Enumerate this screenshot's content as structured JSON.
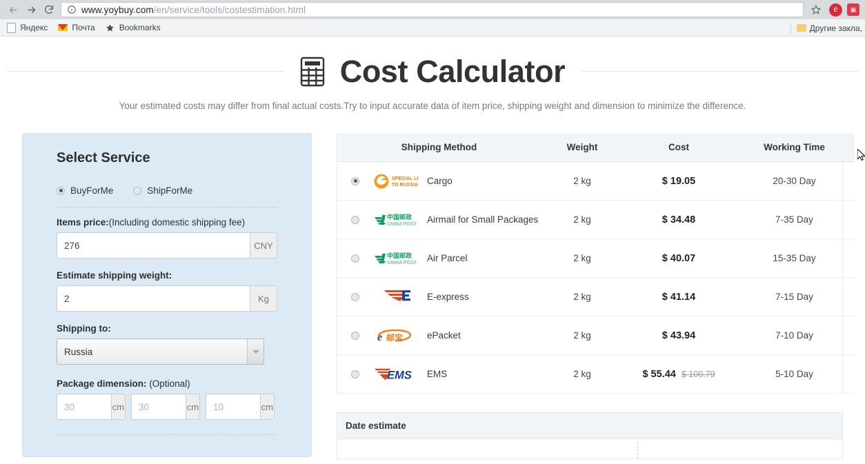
{
  "browser": {
    "back_icon": "back-arrow-icon",
    "forward_icon": "forward-arrow-icon",
    "reload_icon": "reload-icon",
    "url_secure_part": "www.yoybuy.com",
    "url_path_part": "/en/service/tools/costestimation.html",
    "bookmark_star_icon": "star-icon",
    "extensions": [
      {
        "name": "edge-extension-icon",
        "glyph": "e"
      },
      {
        "name": "red-square-extension-icon",
        "glyph": ""
      }
    ],
    "bookmarks": [
      {
        "label": "Яндекс",
        "icon": "page-icon"
      },
      {
        "label": "Почта",
        "icon": "envelope-icon"
      },
      {
        "label": "Bookmarks",
        "icon": "star-icon"
      }
    ],
    "other_bookmarks_label": "Другие закла,",
    "other_bookmarks_icon": "folder-icon"
  },
  "header": {
    "icon": "calculator-icon",
    "title": "Cost Calculator",
    "subtitle": "Your estimated costs may differ from final actual costs.Try to input accurate data of item price, shipping weight and dimension to minimize the difference."
  },
  "form": {
    "title": "Select Service",
    "service_options": [
      {
        "label": "BuyForMe",
        "selected": true
      },
      {
        "label": "ShipForMe",
        "selected": false
      }
    ],
    "items_price": {
      "label_bold": "Items price:",
      "label_normal": "(Including domestic shipping fee)",
      "value": "276",
      "placeholder": "",
      "unit": "CNY"
    },
    "weight": {
      "label": "Estimate shipping weight:",
      "value": "2",
      "placeholder": "",
      "unit": "Kg"
    },
    "shipping_to": {
      "label": "Shipping to:",
      "value": "Russia",
      "arrow_icon": "chevron-down-icon"
    },
    "package_dimension": {
      "label_bold": "Package dimension:",
      "label_normal": "(Optional)",
      "fields": [
        {
          "value": "",
          "placeholder": "30",
          "unit": "cm"
        },
        {
          "value": "",
          "placeholder": "30",
          "unit": "cm"
        },
        {
          "value": "",
          "placeholder": "10",
          "unit": "cm"
        }
      ]
    }
  },
  "results": {
    "columns": [
      "Shipping Method",
      "Weight",
      "Cost",
      "Working Time"
    ],
    "rows": [
      {
        "selected": true,
        "logo": "special-line-to-russia-logo",
        "logo_text_line1": "SPECIAL LINE",
        "logo_text_line2": "TO RUSSIA",
        "method": "Cargo",
        "weight": "2 kg",
        "cost": "$ 19.05",
        "old_cost": "",
        "working_time": "20-30 Day"
      },
      {
        "selected": false,
        "logo": "china-post-logo",
        "logo_text_line1": "中国邮政",
        "logo_text_line2": "CHINA POST",
        "method": "Airmail for Small Packages",
        "weight": "2 kg",
        "cost": "$ 34.48",
        "old_cost": "",
        "working_time": "7-35 Day"
      },
      {
        "selected": false,
        "logo": "china-post-logo",
        "logo_text_line1": "中国邮政",
        "logo_text_line2": "CHINA POST",
        "method": "Air Parcel",
        "weight": "2 kg",
        "cost": "$ 40.07",
        "old_cost": "",
        "working_time": "15-35 Day"
      },
      {
        "selected": false,
        "logo": "e-express-logo",
        "logo_text_line1": "",
        "logo_text_line2": "",
        "method": "E-express",
        "weight": "2 kg",
        "cost": "$ 41.14",
        "old_cost": "",
        "working_time": "7-15 Day"
      },
      {
        "selected": false,
        "logo": "epacket-logo",
        "logo_text_line1": "e",
        "logo_text_line2": "邮宝",
        "method": "ePacket",
        "weight": "2 kg",
        "cost": "$ 43.94",
        "old_cost": "",
        "working_time": "7-10 Day"
      },
      {
        "selected": false,
        "logo": "ems-logo",
        "logo_text_line1": "EMS",
        "logo_text_line2": "",
        "method": "EMS",
        "weight": "2 kg",
        "cost": "$ 55.44",
        "old_cost": "$ 100.79",
        "working_time": "5-10 Day"
      }
    ]
  },
  "date_estimate": {
    "title": "Date estimate"
  },
  "colors": {
    "panel_blue": "#dceaf6",
    "header_gray": "#f2f5f7",
    "china_post_green": "#12a05c",
    "ems_blue": "#1b3f94",
    "ems_red": "#d94a1e",
    "epacket_orange": "#f07d1a",
    "cargo_orange": "#f5a02a",
    "e_express_red": "#e1481f",
    "e_express_blue": "#1e49a0"
  }
}
